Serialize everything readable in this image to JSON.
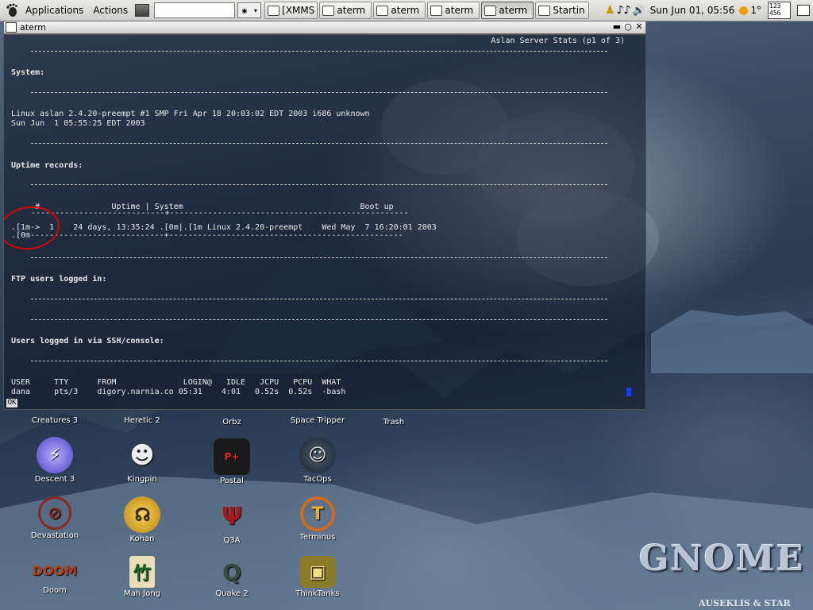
{
  "panel": {
    "menus": [
      "Applications",
      "Actions"
    ],
    "tasks": [
      {
        "label": "[XMMS",
        "active": false
      },
      {
        "label": "aterm",
        "active": false
      },
      {
        "label": "aterm",
        "active": false
      },
      {
        "label": "aterm",
        "active": false
      },
      {
        "label": "aterm",
        "active": true
      },
      {
        "label": "Startin",
        "active": false
      }
    ],
    "clock": "Sun Jun 01, 05:56",
    "weather": "1°",
    "pager": [
      "123",
      "456"
    ]
  },
  "window": {
    "title": "aterm",
    "terminal": {
      "header": "Aslan Server Stats (p1 of 3)",
      "system_heading": "System:",
      "uname": "Linux aslan 2.4.20-preempt #1 SMP Fri Apr 18 20:03:02 EDT 2003 i686 unknown",
      "date": "Sun Jun  1 05:55:25 EDT 2003",
      "uptime_heading": "Uptime records:",
      "uptime_header": "     #               Uptime | System                                     Boot up",
      "uptime_sep": "----------------------------+--------------------------------------------------",
      "uptime_row": ".[1m->  1    24 days, 13:35:24 .[0m|.[1m Linux 2.4.20-preempt    Wed May  7 16:20:01 2003",
      "uptime_row2": ".[0m----------------------------+-------------------------------------------------",
      "ftp_heading": "FTP users logged in:",
      "ssh_heading": "Users logged in via SSH/console:",
      "who_header": "USER     TTY      FROM              LOGIN@   IDLE   JCPU   PCPU  WHAT",
      "who_row": "dana     pts/3    digory.narnia.co 05:31    4:01   0.52s  0.52s  -bash",
      "ok": "OK"
    }
  },
  "desktop": {
    "icons": [
      {
        "label": "Creatures 3",
        "glyph": "✿",
        "color": "#3d6fb5"
      },
      {
        "label": "Heretic 2",
        "glyph": "☠",
        "color": "#6b4a2a"
      },
      {
        "label": "Orbz",
        "glyph": "●",
        "color": "#444444"
      },
      {
        "label": "Space Tripper",
        "glyph": "✈",
        "color": "#555555"
      },
      {
        "label": "Trash",
        "glyph": "🗑",
        "color": "#6c7a8c"
      },
      {
        "label": "Descent 3",
        "glyph": "⚡",
        "color": "#5a4fcf"
      },
      {
        "label": "Kingpin",
        "glyph": "☻",
        "color": "#dddddd"
      },
      {
        "label": "Postal",
        "glyph": "P",
        "color": "#c0301c"
      },
      {
        "label": "TacOps",
        "glyph": "☺",
        "color": "#2f3f4f"
      },
      {
        "label": "Devastation",
        "glyph": "⊘",
        "color": "#8a2a1a"
      },
      {
        "label": "Kohan",
        "glyph": "☊",
        "color": "#d8a51f"
      },
      {
        "label": "Q3A",
        "glyph": "Ψ",
        "color": "#8a1a1a"
      },
      {
        "label": "Terminus",
        "glyph": "T",
        "color": "#c8661e"
      },
      {
        "label": "Doom",
        "glyph": "D",
        "color": "#a0391a"
      },
      {
        "label": "Mah Jong",
        "glyph": "竹",
        "color": "#e0d7b0"
      },
      {
        "label": "Quake 2",
        "glyph": "Q",
        "color": "#3a4a3a"
      },
      {
        "label": "ThinkTanks",
        "glyph": "▣",
        "color": "#8a7a2a"
      }
    ],
    "logo": "GNOME",
    "credit": "AUSEKLIS & STAR"
  }
}
